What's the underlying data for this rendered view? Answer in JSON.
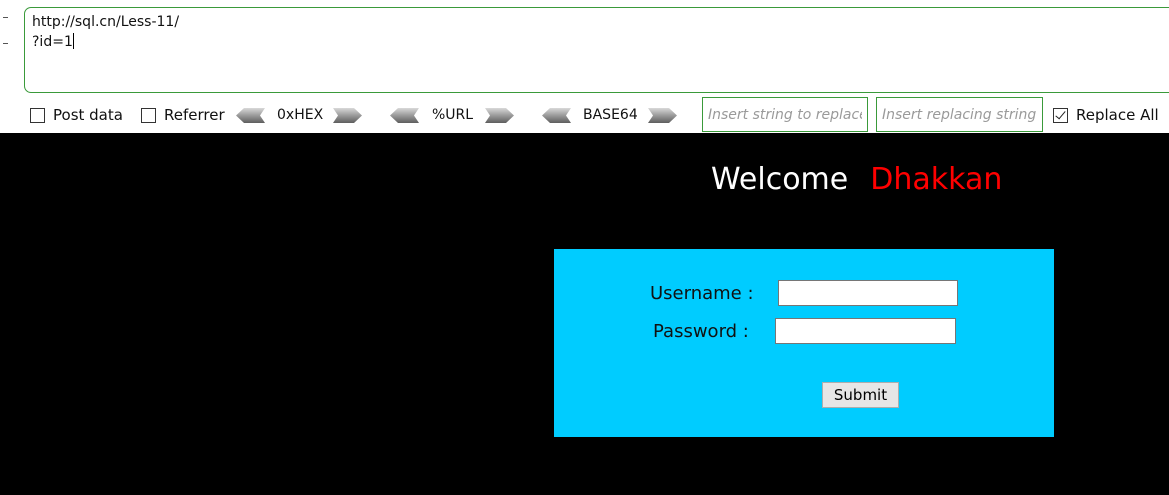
{
  "hackbar": {
    "url_text": "http://sql.cn/Less-11/\n?id=1",
    "options": {
      "post_data": {
        "label": "Post data",
        "checked": false
      },
      "referrer": {
        "label": "Referrer",
        "checked": false
      },
      "replace_all": {
        "label": "Replace All",
        "checked": true
      }
    },
    "encoders": {
      "hex": "0xHEX",
      "url": "%URL",
      "base64": "BASE64"
    },
    "find_placeholder": "Insert string to replace",
    "replace_placeholder": "Insert replacing string"
  },
  "page": {
    "welcome_label": "Welcome",
    "welcome_name": "Dhakkan",
    "username_label": "Username :",
    "password_label": "Password :",
    "submit_label": "Submit",
    "colors": {
      "background": "#000000",
      "welcome_text": "#ffffff",
      "name_text": "#ff0000",
      "login_box": "#00ccff"
    }
  }
}
